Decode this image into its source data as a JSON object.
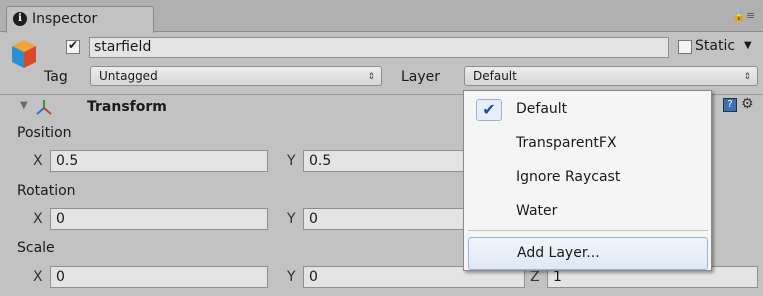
{
  "window": {
    "tab_title": "Inspector"
  },
  "object": {
    "active": true,
    "name": "starfield",
    "static_label": "Static"
  },
  "tag_layer": {
    "tag_label": "Tag",
    "tag_value": "Untagged",
    "layer_label": "Layer",
    "layer_value": "Default"
  },
  "transform": {
    "title": "Transform",
    "position_label": "Position",
    "rotation_label": "Rotation",
    "scale_label": "Scale",
    "axis_x": "X",
    "axis_y": "Y",
    "axis_z": "Z",
    "position": {
      "x": "0.5",
      "y": "0.5"
    },
    "rotation": {
      "x": "0",
      "y": "0"
    },
    "scale": {
      "x": "0",
      "y": "0",
      "z": "1"
    }
  },
  "layer_menu": {
    "selected_index": 0,
    "items": [
      "Default",
      "TransparentFX",
      "Ignore Raycast",
      "Water"
    ],
    "add_layer": "Add Layer..."
  }
}
